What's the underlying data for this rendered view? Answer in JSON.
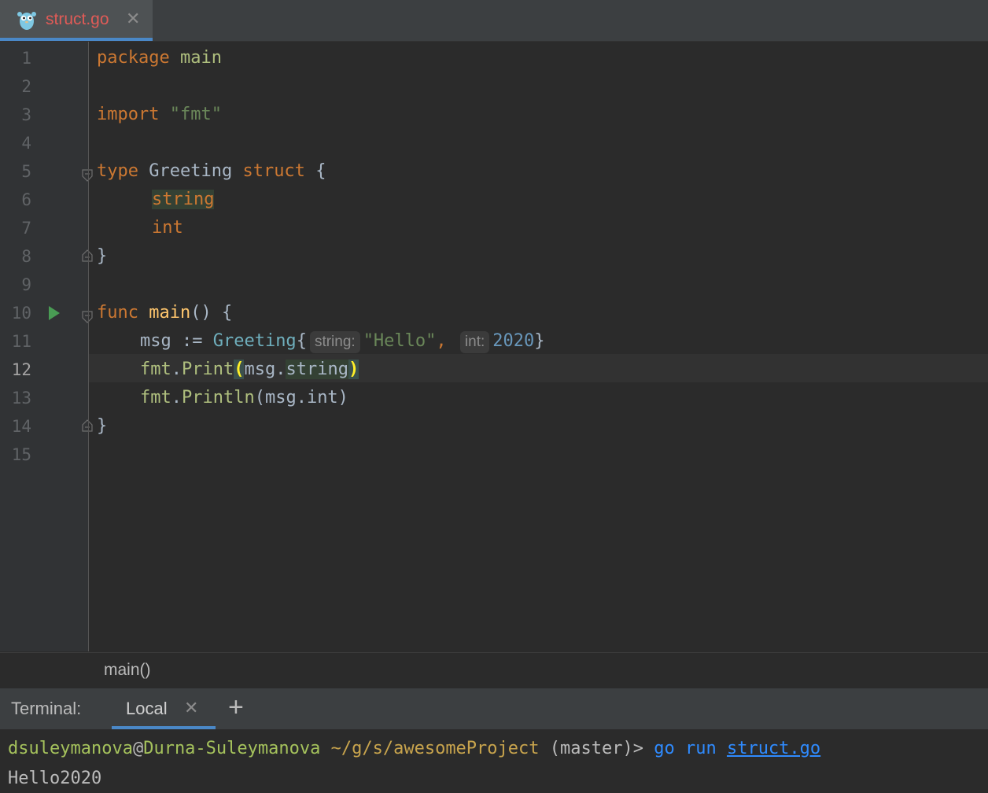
{
  "tab": {
    "title": "struct.go",
    "close": "✕"
  },
  "editor": {
    "line_numbers": [
      "1",
      "2",
      "3",
      "4",
      "5",
      "6",
      "7",
      "8",
      "9",
      "10",
      "11",
      "12",
      "13",
      "14",
      "15"
    ],
    "current_line": "12",
    "code": {
      "l1": {
        "kw": "package",
        "name": "main"
      },
      "l3": {
        "kw": "import",
        "str": "\"fmt\""
      },
      "l5": {
        "kw1": "type",
        "name": "Greeting",
        "kw2": "struct",
        "brace": "{"
      },
      "l6": {
        "type": "string"
      },
      "l7": {
        "type": "int"
      },
      "l8": {
        "brace": "}"
      },
      "l10": {
        "kw": "func",
        "name": "main",
        "rest": "() {"
      },
      "l11": {
        "var": "msg := ",
        "type": "Greeting",
        "open": "{",
        "hint1": "string:",
        "str": "\"Hello\"",
        "comma": ",",
        "hint2": "int:",
        "num": "2020",
        "close": "}"
      },
      "l12": {
        "pkg": "fmt",
        "dot": ".",
        "fn": "Print",
        "open": "(",
        "arg": "msg.",
        "field": "string",
        "close": ")"
      },
      "l13": {
        "pkg": "fmt",
        "dot": ".",
        "fn": "Println",
        "rest": "(msg.int)"
      },
      "l14": {
        "brace": "}"
      }
    }
  },
  "breadcrumb": {
    "label": "main()"
  },
  "terminal": {
    "label": "Terminal:",
    "tab_label": "Local",
    "tab_close": "✕",
    "add": "+",
    "prompt": {
      "user": "dsuleymanova",
      "at": "@",
      "host": "Durna-Suleymanova",
      "path": " ~/g/s/awesomeProject",
      "branch": " (master)> ",
      "cmd": "go run ",
      "file": "struct.go"
    },
    "output": "Hello2020"
  },
  "colors": {
    "accent": "#4a88c7",
    "background": "#2b2b2b",
    "keyword": "#cc7832",
    "function": "#ffc66d",
    "string": "#6a8759",
    "number": "#6897bb",
    "run": "#499c54"
  }
}
